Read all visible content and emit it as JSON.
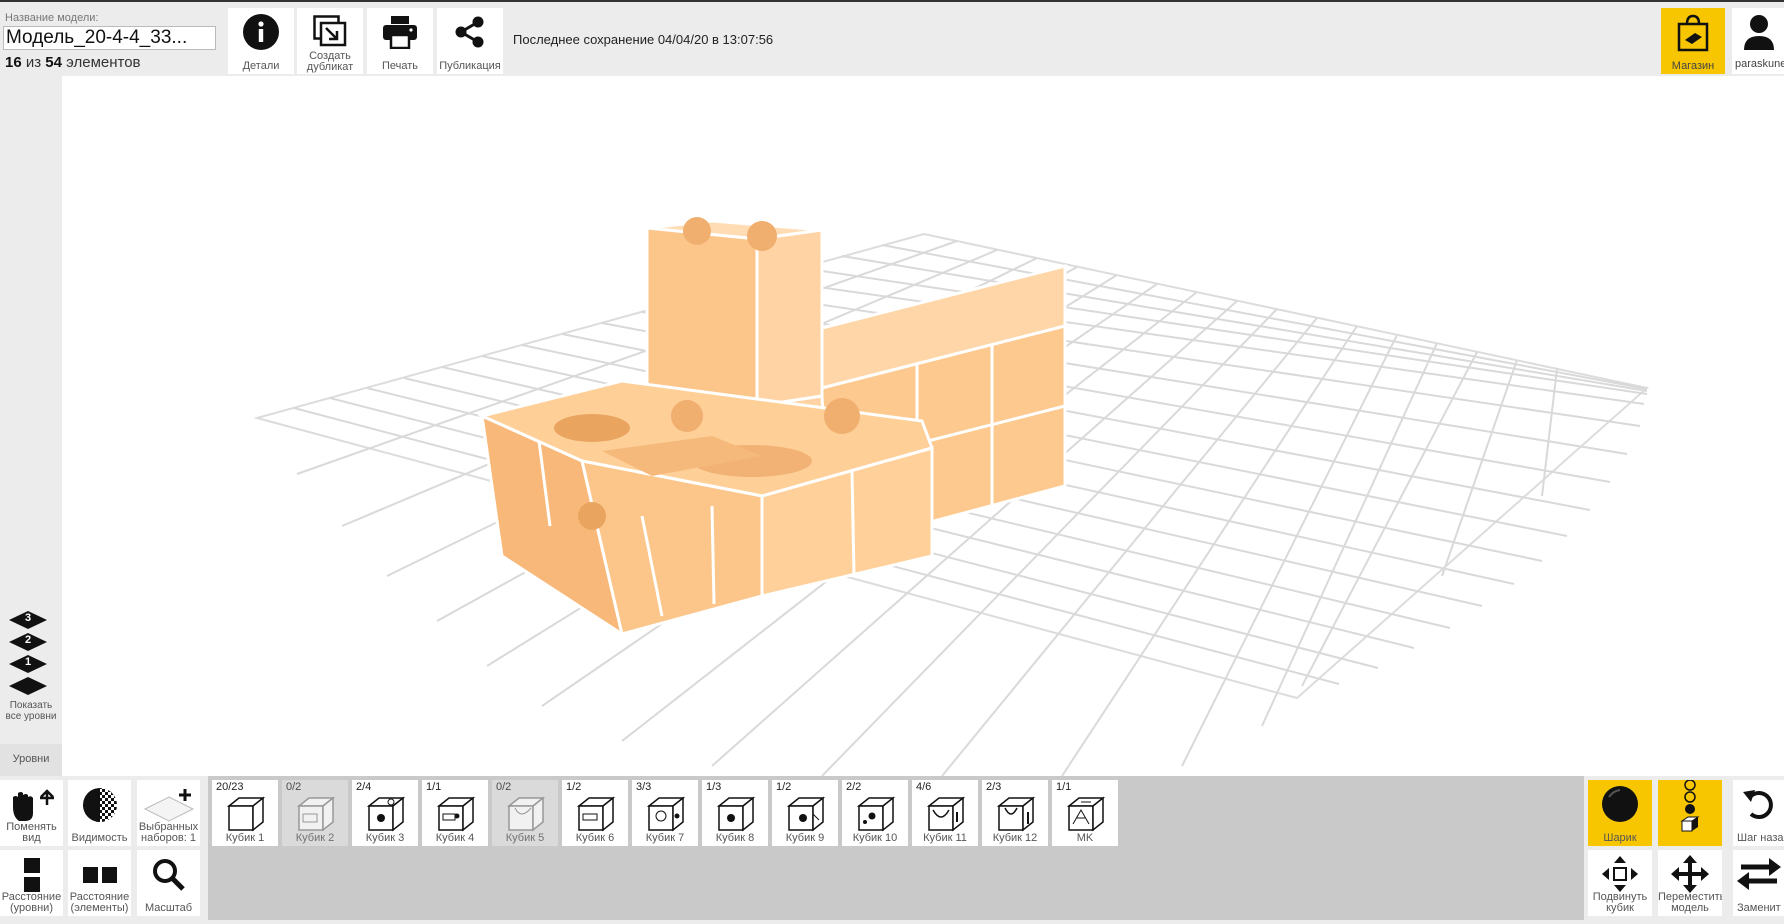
{
  "header": {
    "model_label": "Название модели:",
    "model_name": "Модель_20-4-4_33...",
    "count_current": "16",
    "count_of": "из",
    "count_total": "54",
    "count_suffix": "элементов",
    "last_save": "Последнее сохранение 04/04/20 в 13:07:56"
  },
  "toolbar": {
    "details": "Детали",
    "duplicate_line1": "Создать",
    "duplicate_line2": "дубликат",
    "print": "Печать",
    "publish": "Публикация"
  },
  "shop": {
    "label": "Магазин"
  },
  "user": {
    "name": "paraskune"
  },
  "levels": {
    "level3": "3",
    "level2": "2",
    "level1": "1",
    "show_all_line1": "Показать",
    "show_all_line2": "все уровни",
    "tab": "Уровни"
  },
  "view_tools": {
    "change_view_line1": "Поменять",
    "change_view_line2": "вид",
    "visibility": "Видимость",
    "selected_sets_line1": "Выбранных",
    "selected_sets_line2": "наборов: 1",
    "distance_levels_line1": "Расстояние",
    "distance_levels_line2": "(уровни)",
    "distance_elements_line1": "Расстояние",
    "distance_elements_line2": "(элементы)",
    "zoom": "Масштаб"
  },
  "cubes": [
    {
      "count": "20/23",
      "label": "Кубик 1",
      "enabled": true
    },
    {
      "count": "0/2",
      "label": "Кубик 2",
      "enabled": false
    },
    {
      "count": "2/4",
      "label": "Кубик 3",
      "enabled": true
    },
    {
      "count": "1/1",
      "label": "Кубик 4",
      "enabled": true
    },
    {
      "count": "0/2",
      "label": "Кубик 5",
      "enabled": false
    },
    {
      "count": "1/2",
      "label": "Кубик 6",
      "enabled": true
    },
    {
      "count": "3/3",
      "label": "Кубик  7",
      "enabled": true
    },
    {
      "count": "1/3",
      "label": "Кубик  8",
      "enabled": true
    },
    {
      "count": "1/2",
      "label": "Кубик 9",
      "enabled": true
    },
    {
      "count": "2/2",
      "label": "Кубик 10",
      "enabled": true
    },
    {
      "count": "4/6",
      "label": "Кубик 11",
      "enabled": true
    },
    {
      "count": "2/3",
      "label": "Кубик 12",
      "enabled": true
    },
    {
      "count": "1/1",
      "label": "MK",
      "enabled": true
    }
  ],
  "right_tools": {
    "ball": "Шарик",
    "undo": "Шаг наза",
    "move_cube_line1": "Подвинуть",
    "move_cube_line2": "кубик",
    "move_model_line1": "Переместить",
    "move_model_line2": "модель",
    "replace": "Заменит"
  },
  "colors": {
    "accent": "#f7c600",
    "cube": "#fccf98",
    "panel": "#ececec",
    "strip": "#c9c9c9"
  }
}
